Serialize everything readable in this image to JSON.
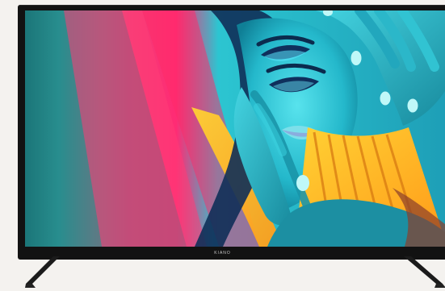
{
  "product": {
    "brand_label": "KIANO"
  }
}
